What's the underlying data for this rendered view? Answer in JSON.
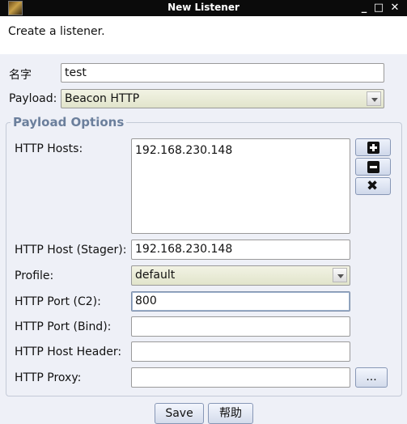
{
  "window": {
    "title": "New Listener",
    "controls": {
      "minimize": "_",
      "maximize": "□",
      "close": "✕"
    }
  },
  "header": {
    "description": "Create a listener."
  },
  "form": {
    "name_label": "名字",
    "name_value": "test",
    "payload_label": "Payload:",
    "payload_value": "Beacon HTTP"
  },
  "payload_options": {
    "title": "Payload Options",
    "hosts_label": "HTTP Hosts:",
    "hosts": [
      "192.168.230.148"
    ],
    "host_stager_label": "HTTP Host (Stager):",
    "host_stager_value": "192.168.230.148",
    "profile_label": "Profile:",
    "profile_value": "default",
    "port_c2_label": "HTTP Port (C2):",
    "port_c2_value": "800",
    "port_bind_label": "HTTP Port (Bind):",
    "port_bind_value": "",
    "host_header_label": "HTTP Host Header:",
    "host_header_value": "",
    "proxy_label": "HTTP Proxy:",
    "proxy_value": "",
    "proxy_button_label": "...",
    "host_buttons": {
      "add_icon": "plus-icon",
      "remove_icon": "minus-icon",
      "clear_icon": "x-icon"
    }
  },
  "footer": {
    "save_label": "Save",
    "help_label": "帮助"
  }
}
